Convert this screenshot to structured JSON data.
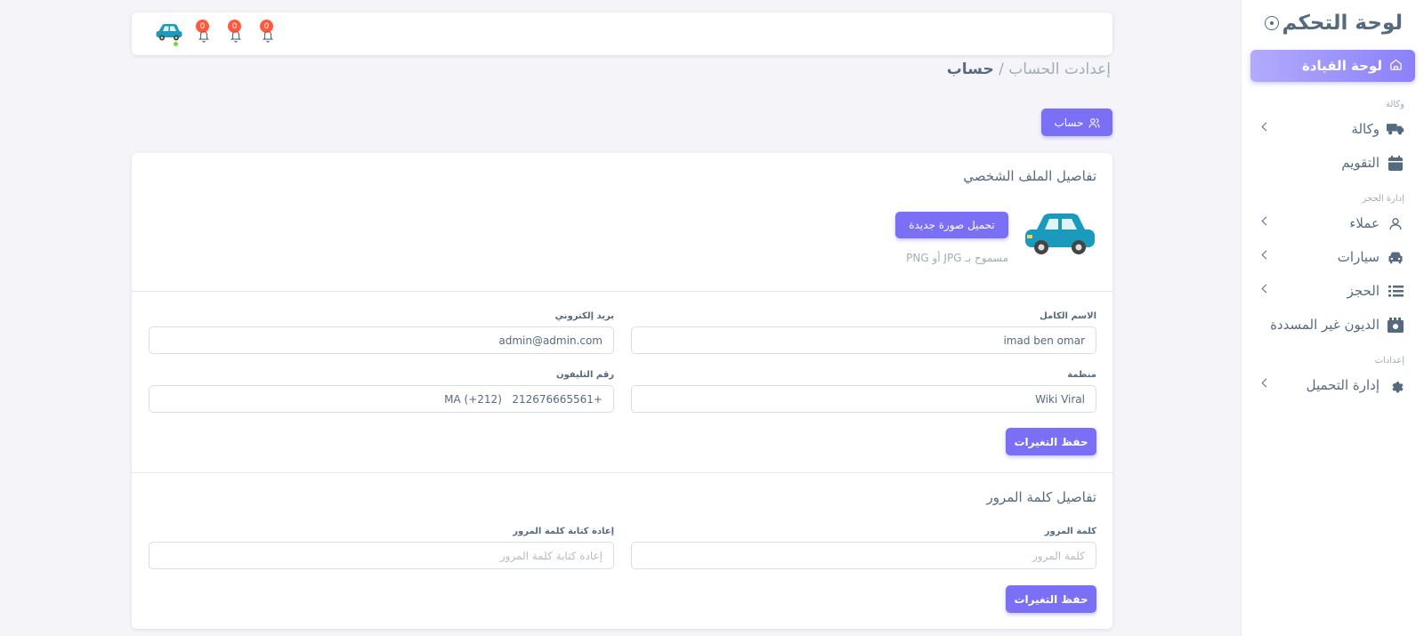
{
  "sidebar": {
    "brand": "لوحة التحكم",
    "toggle_icon": "circle-dot-icon",
    "active_item": {
      "label": "لوحة القيادة",
      "icon": "home-icon"
    },
    "sections": [
      {
        "header": "وكالة",
        "items": [
          {
            "label": "وكالة",
            "icon": "truck-icon",
            "chevron": true
          },
          {
            "label": "التقويم",
            "icon": "calendar-icon",
            "chevron": false
          }
        ]
      },
      {
        "header": "إدارة الحجز",
        "items": [
          {
            "label": "عملاء",
            "icon": "user-icon",
            "chevron": true
          },
          {
            "label": "سيارات",
            "icon": "car-icon",
            "chevron": true
          },
          {
            "label": "الحجز",
            "icon": "list-icon",
            "chevron": true
          },
          {
            "label": "الديون غير المسددة",
            "icon": "money-icon",
            "chevron": false
          }
        ]
      },
      {
        "header": "إعدادات",
        "items": [
          {
            "label": "إدارة التحميل",
            "icon": "gear-icon",
            "chevron": true
          }
        ]
      }
    ]
  },
  "navbar": {
    "notifications": [
      {
        "count": "0"
      },
      {
        "count": "0"
      },
      {
        "count": "0"
      }
    ],
    "status_color": "#71dd37"
  },
  "breadcrumb": {
    "parent": "إعدادت الحساب /",
    "current": "حساب"
  },
  "tab": {
    "label": "حساب",
    "icon": "users-icon"
  },
  "profile": {
    "title": "تفاصيل الملف الشخصي",
    "upload_label": "تحميل صورة جديدة",
    "upload_hint": "مسموح بـ JPG أو PNG",
    "full_name_label": "الاسم الكامل",
    "full_name_value": "imad ben omar",
    "email_label": "بريد إلكتروني",
    "email_value": "admin@admin.com",
    "org_label": "منظمة",
    "org_value": "Wiki Viral",
    "phone_label": "رقم التليفون",
    "phone_value": "MA (+212)   212676665561+",
    "save_label": "حفظ التغيرات"
  },
  "password": {
    "title": "تفاصيل كلمة المرور",
    "password_label": "كلمة المرور",
    "password_placeholder": "كلمة المرور",
    "confirm_label": "إعادة كتابة كلمة المرور",
    "confirm_placeholder": "إعادة كتابة كلمة المرور",
    "save_label": "حفظ التغيرات"
  },
  "colors": {
    "primary": "#7b6ff6",
    "text": "#566a7f",
    "muted": "#a1acb8",
    "badge": "#ff3e1d"
  }
}
